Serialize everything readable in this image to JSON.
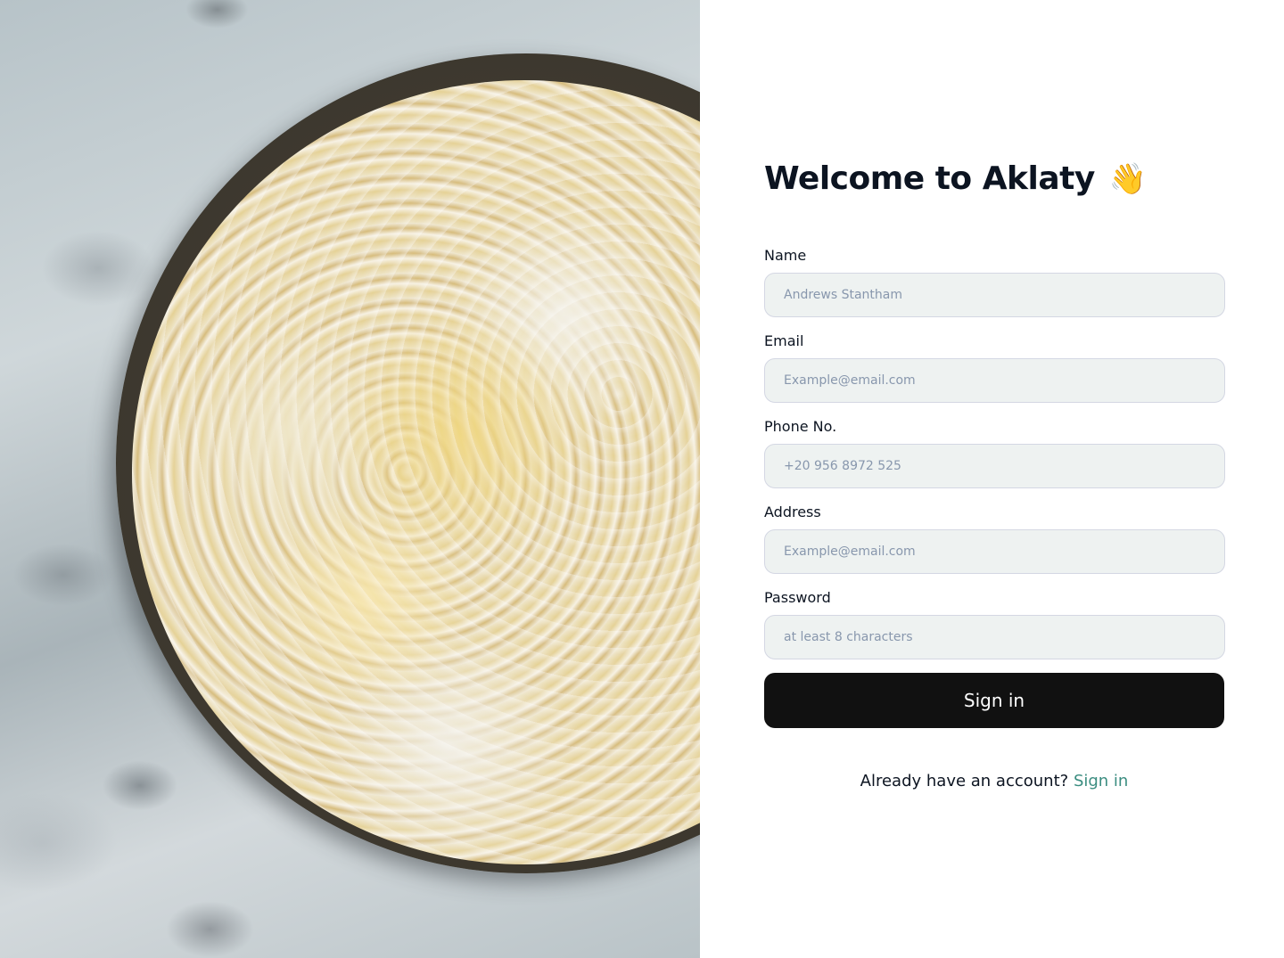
{
  "hero": {
    "icon": "popcorn-bowl-photo"
  },
  "header": {
    "title": "Welcome to Aklaty",
    "wave_emoji": "👋"
  },
  "form": {
    "fields": [
      {
        "label": "Name",
        "placeholder": "Andrews Stantham",
        "value": ""
      },
      {
        "label": "Email",
        "placeholder": "Example@email.com",
        "value": ""
      },
      {
        "label": "Phone No.",
        "placeholder": "+20 956 8972 525",
        "value": ""
      },
      {
        "label": "Address",
        "placeholder": "Example@email.com",
        "value": ""
      },
      {
        "label": "Password",
        "placeholder": "at least 8 characters",
        "value": ""
      }
    ],
    "submit_label": "Sign in"
  },
  "footer": {
    "prompt": "Already have an account?",
    "link_label": "Sign in"
  },
  "colors": {
    "button_bg": "#111111",
    "link": "#3b8d80",
    "input_bg": "#eef2f1",
    "input_border": "#d4d7e3",
    "text": "#0c1421",
    "placeholder": "#8897ad"
  }
}
